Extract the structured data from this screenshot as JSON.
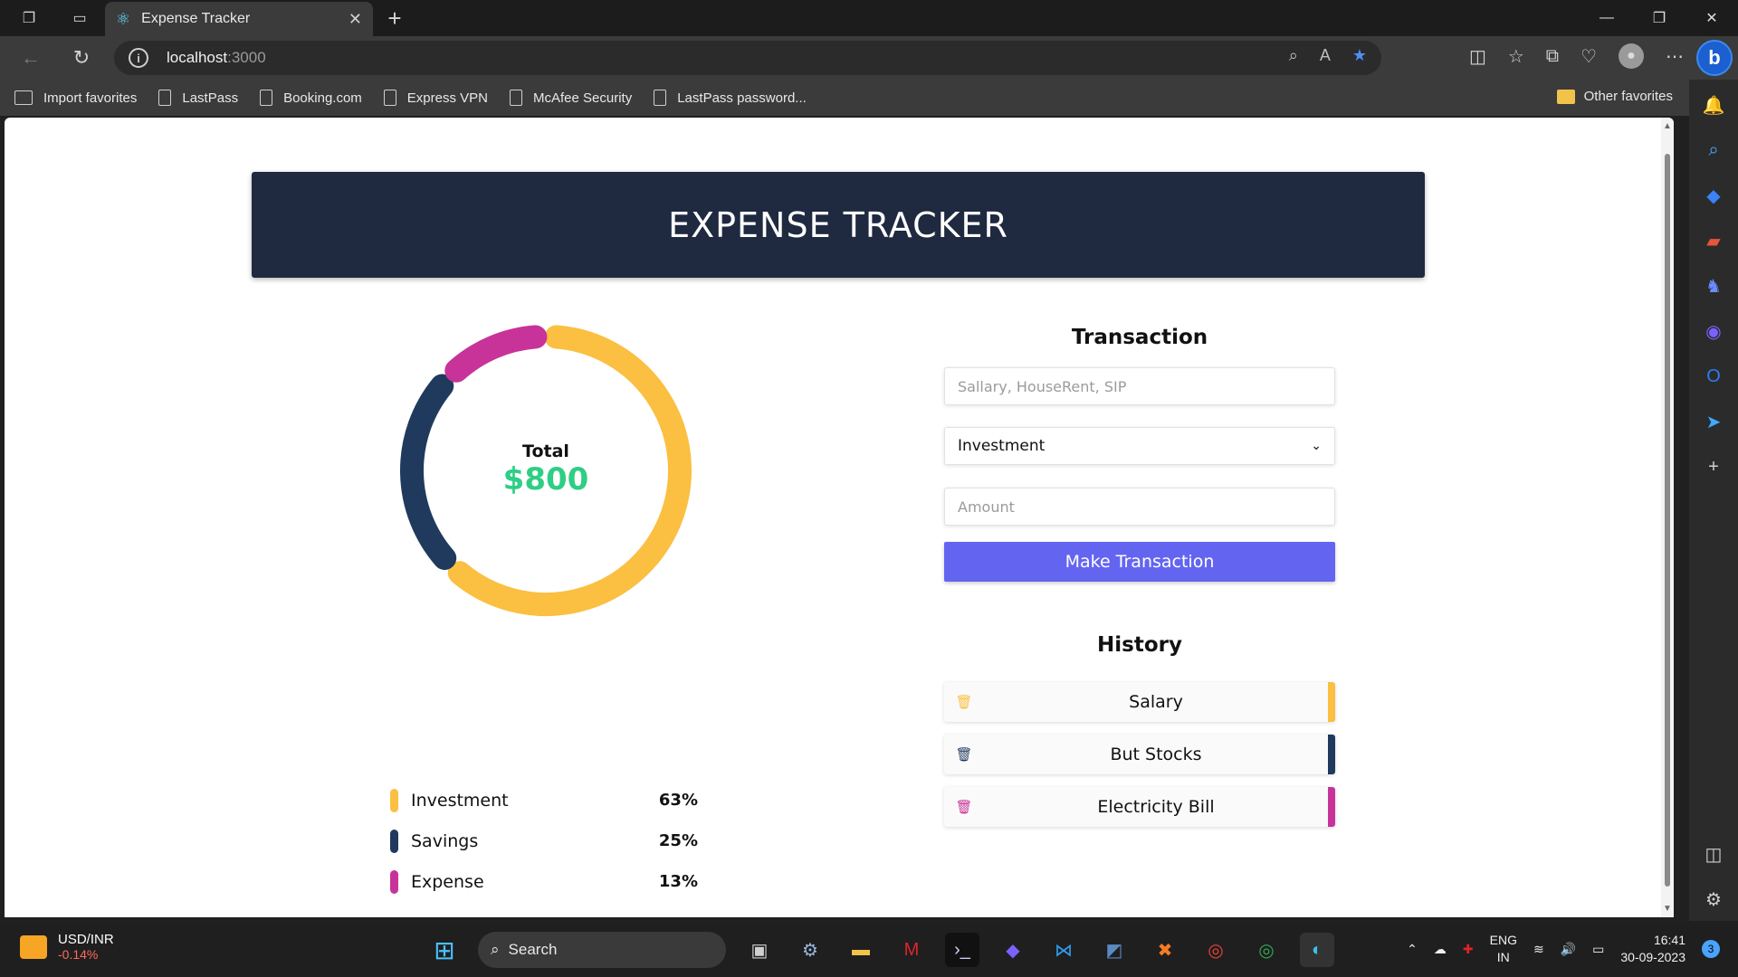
{
  "browser": {
    "tab_title": "Expense Tracker",
    "url_host": "localhost",
    "url_port": ":3000"
  },
  "favorites": {
    "items": [
      "Import favorites",
      "LastPass",
      "Booking.com",
      "Express VPN",
      "McAfee Security",
      "LastPass password..."
    ],
    "other": "Other favorites"
  },
  "app": {
    "title": "EXPENSE TRACKER",
    "total_label": "Total",
    "total_value": "$800",
    "legend": [
      {
        "name": "Investment",
        "pct": "63%",
        "color": "#fbbf41"
      },
      {
        "name": "Savings",
        "pct": "25%",
        "color": "#1f3a5c"
      },
      {
        "name": "Expense",
        "pct": "13%",
        "color": "#c8339a"
      }
    ],
    "transaction": {
      "heading": "Transaction",
      "name_placeholder": "Sallary, HouseRent, SIP",
      "type_selected": "Investment",
      "amount_placeholder": "Amount",
      "submit_label": "Make Transaction"
    },
    "history": {
      "heading": "History",
      "items": [
        {
          "label": "Salary",
          "color": "#fbbf41"
        },
        {
          "label": "But Stocks",
          "color": "#1f3a5c"
        },
        {
          "label": "Electricity Bill",
          "color": "#c8339a"
        }
      ]
    }
  },
  "chart_data": {
    "type": "pie",
    "categories": [
      "Investment",
      "Savings",
      "Expense"
    ],
    "values": [
      63,
      25,
      13
    ],
    "colors": [
      "#fbbf41",
      "#1f3a5c",
      "#c8339a"
    ]
  },
  "taskbar": {
    "ticker": "USD/INR",
    "ticker_change": "-0.14%",
    "search": "Search",
    "lang_top": "ENG",
    "lang_bottom": "IN",
    "time": "16:41",
    "date": "30-09-2023",
    "notifications": "3"
  }
}
